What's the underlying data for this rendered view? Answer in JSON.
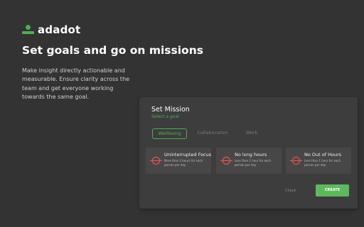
{
  "brand": {
    "name": "adadot"
  },
  "hero": {
    "headline": "Set goals and go on missions",
    "description": "Make insight directly actionable and measurable. Ensure clarity across the team and get everyone working towards the same goal."
  },
  "mission_card": {
    "title": "Set Mission",
    "subtitle": "Select a goal",
    "tabs": [
      {
        "label": "Wellbeing",
        "active": true
      },
      {
        "label": "Collaboration",
        "active": false
      },
      {
        "label": "Work",
        "active": false
      }
    ],
    "goals": [
      {
        "title": "Uninterrupted Focus",
        "text": "More than 2 hours for each person per day",
        "icon": "gauge-icon"
      },
      {
        "title": "No long hours",
        "text": "Less than 1 hour for each person per day",
        "icon": "gauge-icon"
      },
      {
        "title": "No Out of Hours",
        "text": "Less than 1 hour for each person per day",
        "icon": "gauge-icon"
      }
    ],
    "check_label": "Check",
    "create_label": "CREATE"
  },
  "colors": {
    "background": "#333333",
    "card": "#3d3d3d",
    "accent": "#4caf50",
    "icon_red": "#e05252"
  }
}
